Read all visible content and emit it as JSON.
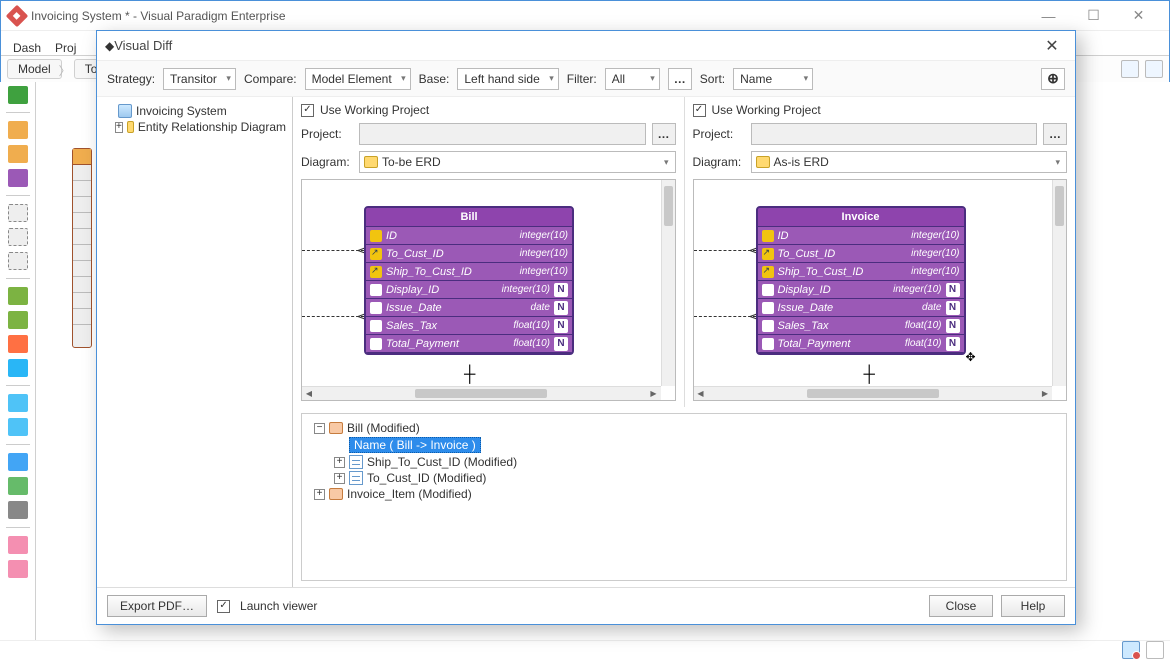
{
  "app": {
    "title": "Invoicing System * - Visual Paradigm Enterprise",
    "menu": [
      "Dash",
      "Proj"
    ],
    "path": [
      "Model",
      "To"
    ]
  },
  "modal": {
    "title": "Visual Diff",
    "toolbar": {
      "strategy_label": "Strategy:",
      "strategy_value": "Transitor",
      "compare_label": "Compare:",
      "compare_value": "Model Element",
      "base_label": "Base:",
      "base_value": "Left hand side",
      "filter_label": "Filter:",
      "filter_value": "All",
      "sort_label": "Sort:",
      "sort_value": "Name"
    },
    "tree": {
      "root": "Invoicing System",
      "child": "Entity Relationship Diagram"
    },
    "left_pane": {
      "use_working_label": "Use Working Project",
      "project_label": "Project:",
      "project_value": "",
      "diagram_label": "Diagram:",
      "diagram_value": "To-be ERD"
    },
    "right_pane": {
      "use_working_label": "Use Working Project",
      "project_label": "Project:",
      "project_value": "",
      "diagram_label": "Diagram:",
      "diagram_value": "As-is ERD"
    },
    "entity_left": {
      "name": "Bill",
      "cols": [
        {
          "ic": "key",
          "name": "ID",
          "type": "integer(10)",
          "n": false
        },
        {
          "ic": "fk",
          "name": "To_Cust_ID",
          "type": "integer(10)",
          "n": false
        },
        {
          "ic": "fk",
          "name": "Ship_To_Cust_ID",
          "type": "integer(10)",
          "n": false
        },
        {
          "ic": "col",
          "name": "Display_ID",
          "type": "integer(10)",
          "n": true
        },
        {
          "ic": "col",
          "name": "Issue_Date",
          "type": "date",
          "n": true
        },
        {
          "ic": "col",
          "name": "Sales_Tax",
          "type": "float(10)",
          "n": true
        },
        {
          "ic": "col",
          "name": "Total_Payment",
          "type": "float(10)",
          "n": true
        }
      ]
    },
    "entity_right": {
      "name": "Invoice",
      "cols": [
        {
          "ic": "key",
          "name": "ID",
          "type": "integer(10)",
          "n": false
        },
        {
          "ic": "fk",
          "name": "To_Cust_ID",
          "type": "integer(10)",
          "n": false
        },
        {
          "ic": "fk",
          "name": "Ship_To_Cust_ID",
          "type": "integer(10)",
          "n": false
        },
        {
          "ic": "col",
          "name": "Display_ID",
          "type": "integer(10)",
          "n": true
        },
        {
          "ic": "col",
          "name": "Issue_Date",
          "type": "date",
          "n": true
        },
        {
          "ic": "col",
          "name": "Sales_Tax",
          "type": "float(10)",
          "n": true
        },
        {
          "ic": "col",
          "name": "Total_Payment",
          "type": "float(10)",
          "n": true
        }
      ]
    },
    "diff_tree": {
      "items": [
        {
          "lvl": 1,
          "exp": "−",
          "icon": "folder-red",
          "label": "Bill (Modified)"
        },
        {
          "lvl": 2,
          "exp": "",
          "icon": "",
          "label": "Name ( Bill -> Invoice )",
          "selected": true
        },
        {
          "lvl": 2,
          "exp": "+",
          "icon": "col",
          "label": "Ship_To_Cust_ID (Modified)"
        },
        {
          "lvl": 2,
          "exp": "+",
          "icon": "col",
          "label": "To_Cust_ID (Modified)"
        },
        {
          "lvl": 1,
          "exp": "+",
          "icon": "folder-red",
          "label": "Invoice_Item (Modified)"
        }
      ]
    },
    "footer": {
      "export_label": "Export PDF…",
      "launch_label": "Launch viewer",
      "close_label": "Close",
      "help_label": "Help"
    }
  }
}
